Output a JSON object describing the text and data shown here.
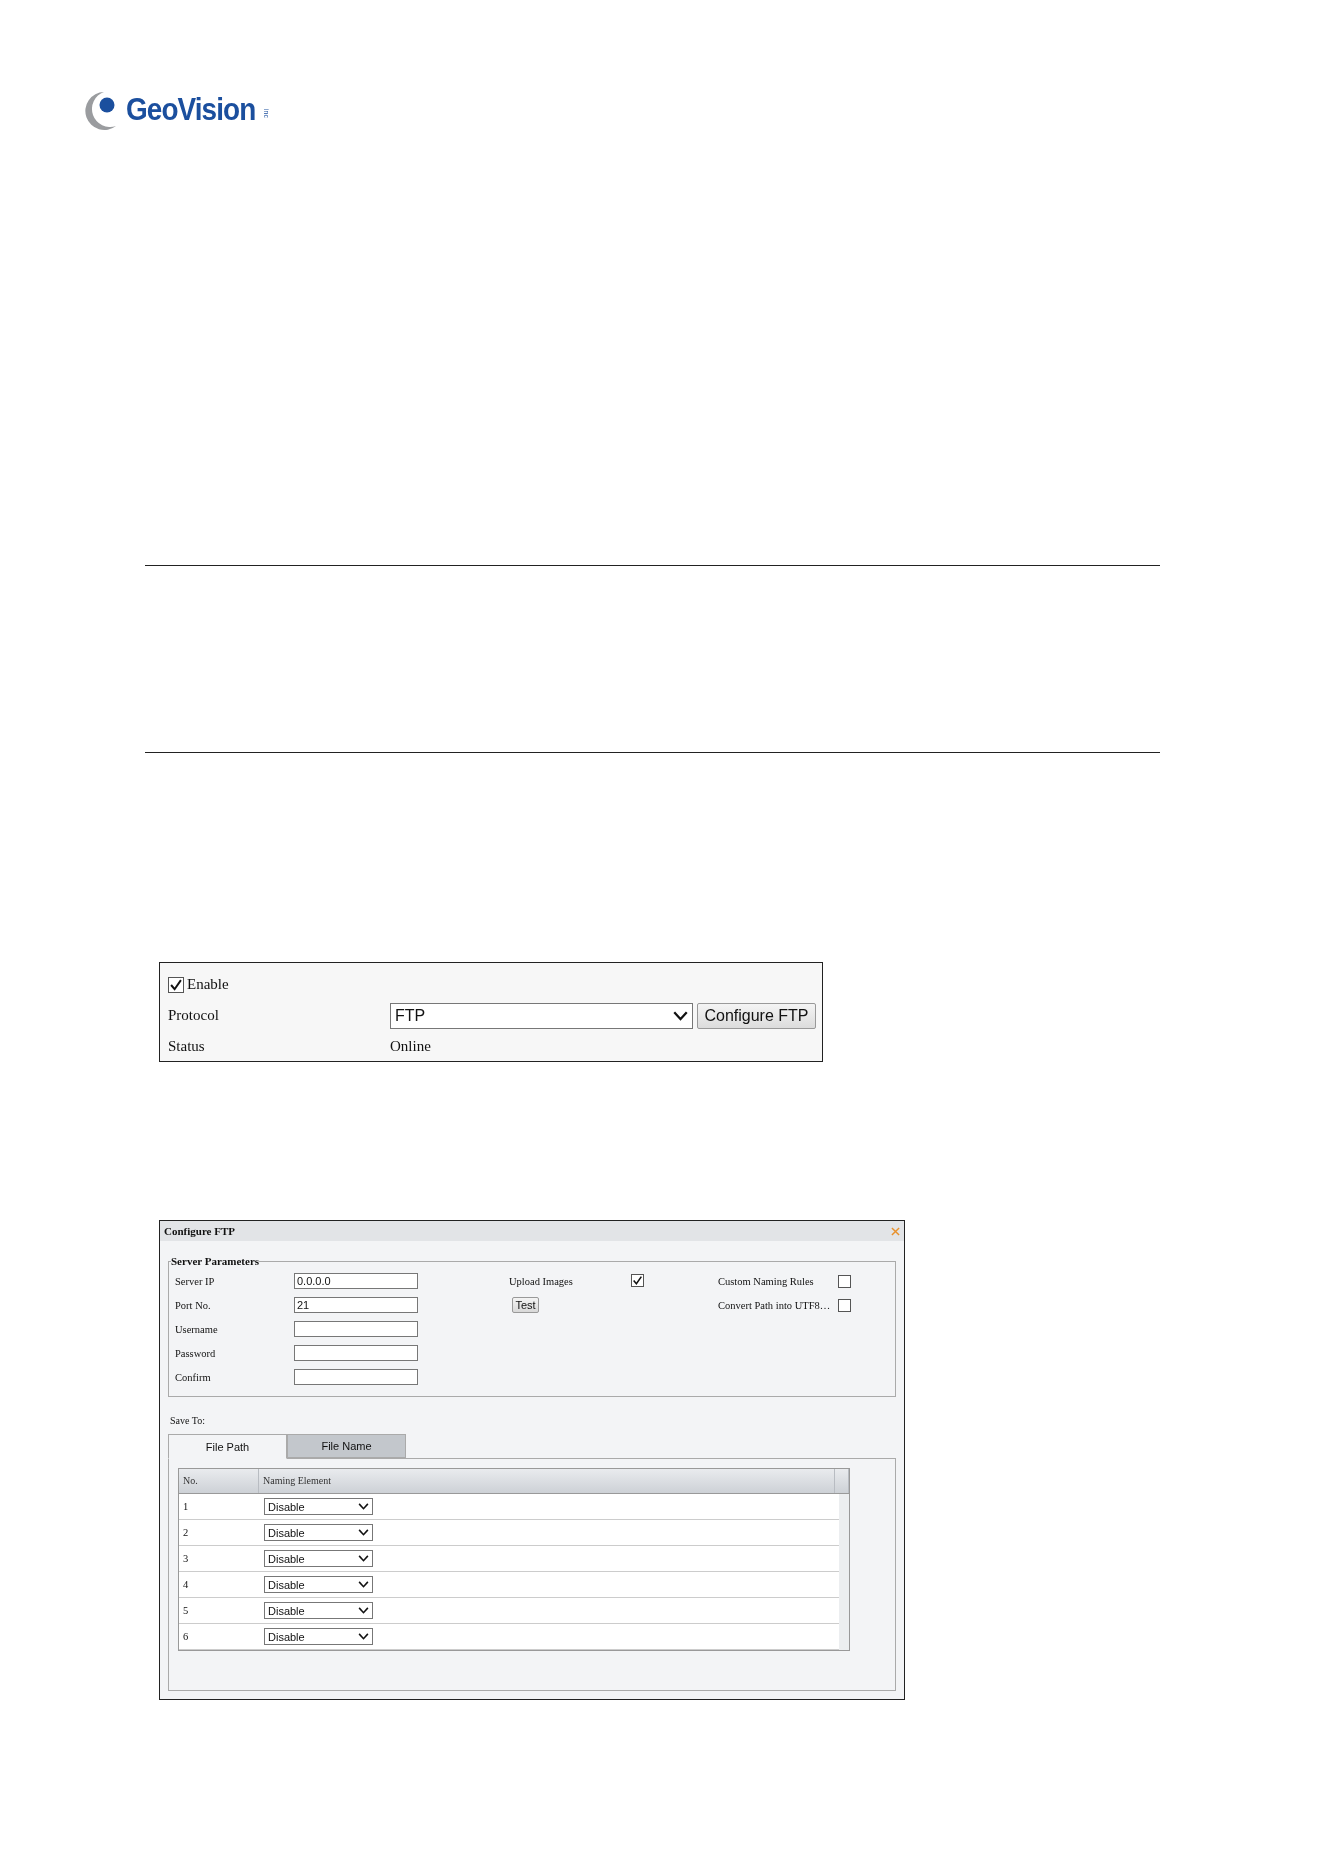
{
  "logo": {
    "name": "GeoVision",
    "suffix": "inc"
  },
  "ftp_panel": {
    "enable": {
      "label": "Enable",
      "checked": true
    },
    "protocol": {
      "label": "Protocol",
      "value": "FTP"
    },
    "configure_button": "Configure FTP",
    "status": {
      "label": "Status",
      "value": "Online"
    }
  },
  "dialog": {
    "title": "Configure FTP",
    "server_parameters": {
      "legend": "Server Parameters",
      "fields": [
        {
          "label": "Server IP",
          "value": "0.0.0.0"
        },
        {
          "label": "Port No.",
          "value": "21"
        },
        {
          "label": "Username"
        },
        {
          "label": "Password"
        },
        {
          "label": "Confirm"
        }
      ],
      "upload_images": {
        "label": "Upload Images",
        "checked": true
      },
      "test_button": "Test",
      "options": [
        {
          "label": "Custom Naming Rules",
          "checked": false
        },
        {
          "label": "Convert Path into UTF8…",
          "checked": false
        }
      ]
    },
    "save_to": "Save To:",
    "tabs": [
      {
        "label": "File Path",
        "selected": true
      },
      {
        "label": "File Name",
        "selected": false
      }
    ],
    "table": {
      "columns": [
        "No.",
        "Naming Element"
      ],
      "rows": [
        {
          "no": "1",
          "element": "Disable"
        },
        {
          "no": "2",
          "element": "Disable"
        },
        {
          "no": "3",
          "element": "Disable"
        },
        {
          "no": "4",
          "element": "Disable"
        },
        {
          "no": "5",
          "element": "Disable"
        },
        {
          "no": "6",
          "element": "Disable"
        }
      ]
    }
  }
}
